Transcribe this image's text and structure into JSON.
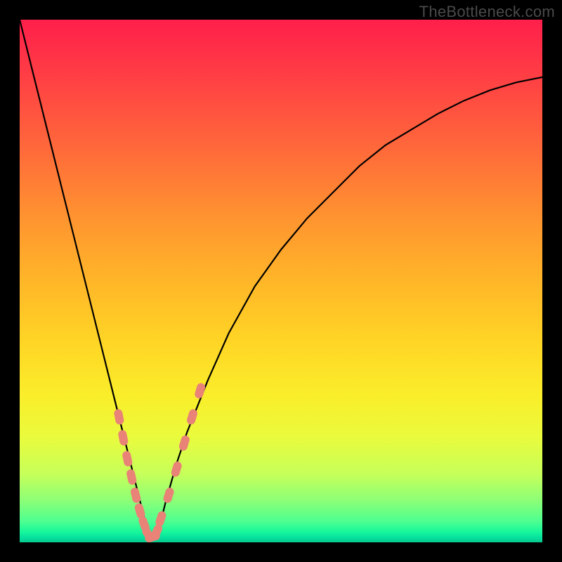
{
  "watermark": "TheBottleneck.com",
  "colors": {
    "background": "#000000",
    "curve": "#000000",
    "marker": "#e98377",
    "gradient_top": "#ff1f4b",
    "gradient_bottom": "#06c88e"
  },
  "chart_data": {
    "type": "line",
    "title": "",
    "xlabel": "",
    "ylabel": "",
    "xlim": [
      0,
      100
    ],
    "ylim": [
      0,
      100
    ],
    "grid": false,
    "legend": false,
    "series": [
      {
        "name": "bottleneck-curve",
        "x": [
          0,
          2,
          4,
          6,
          8,
          10,
          12,
          14,
          16,
          18,
          20,
          21,
          22,
          23,
          24,
          25,
          26,
          27,
          28,
          30,
          32,
          34,
          36,
          40,
          45,
          50,
          55,
          60,
          65,
          70,
          75,
          80,
          85,
          90,
          95,
          100
        ],
        "values": [
          100,
          92,
          84,
          76,
          68,
          60,
          52,
          44,
          36,
          28,
          20,
          16,
          12,
          8,
          4,
          1,
          1,
          4,
          8,
          15,
          21,
          26,
          31,
          40,
          49,
          56,
          62,
          67,
          72,
          76,
          79,
          82,
          84.5,
          86.5,
          88,
          89
        ]
      }
    ],
    "markers": {
      "name": "highlighted-points",
      "color": "#e98377",
      "x": [
        19.0,
        19.8,
        20.6,
        21.4,
        22.2,
        23.0,
        23.8,
        24.6,
        25.4,
        26.2,
        27.0,
        28.5,
        30.0,
        31.5,
        33.0,
        34.5
      ],
      "values": [
        24.0,
        20.0,
        16.0,
        12.5,
        9.0,
        6.0,
        3.5,
        1.5,
        1.0,
        2.0,
        4.5,
        9.0,
        14.0,
        19.0,
        24.0,
        29.0
      ]
    }
  }
}
